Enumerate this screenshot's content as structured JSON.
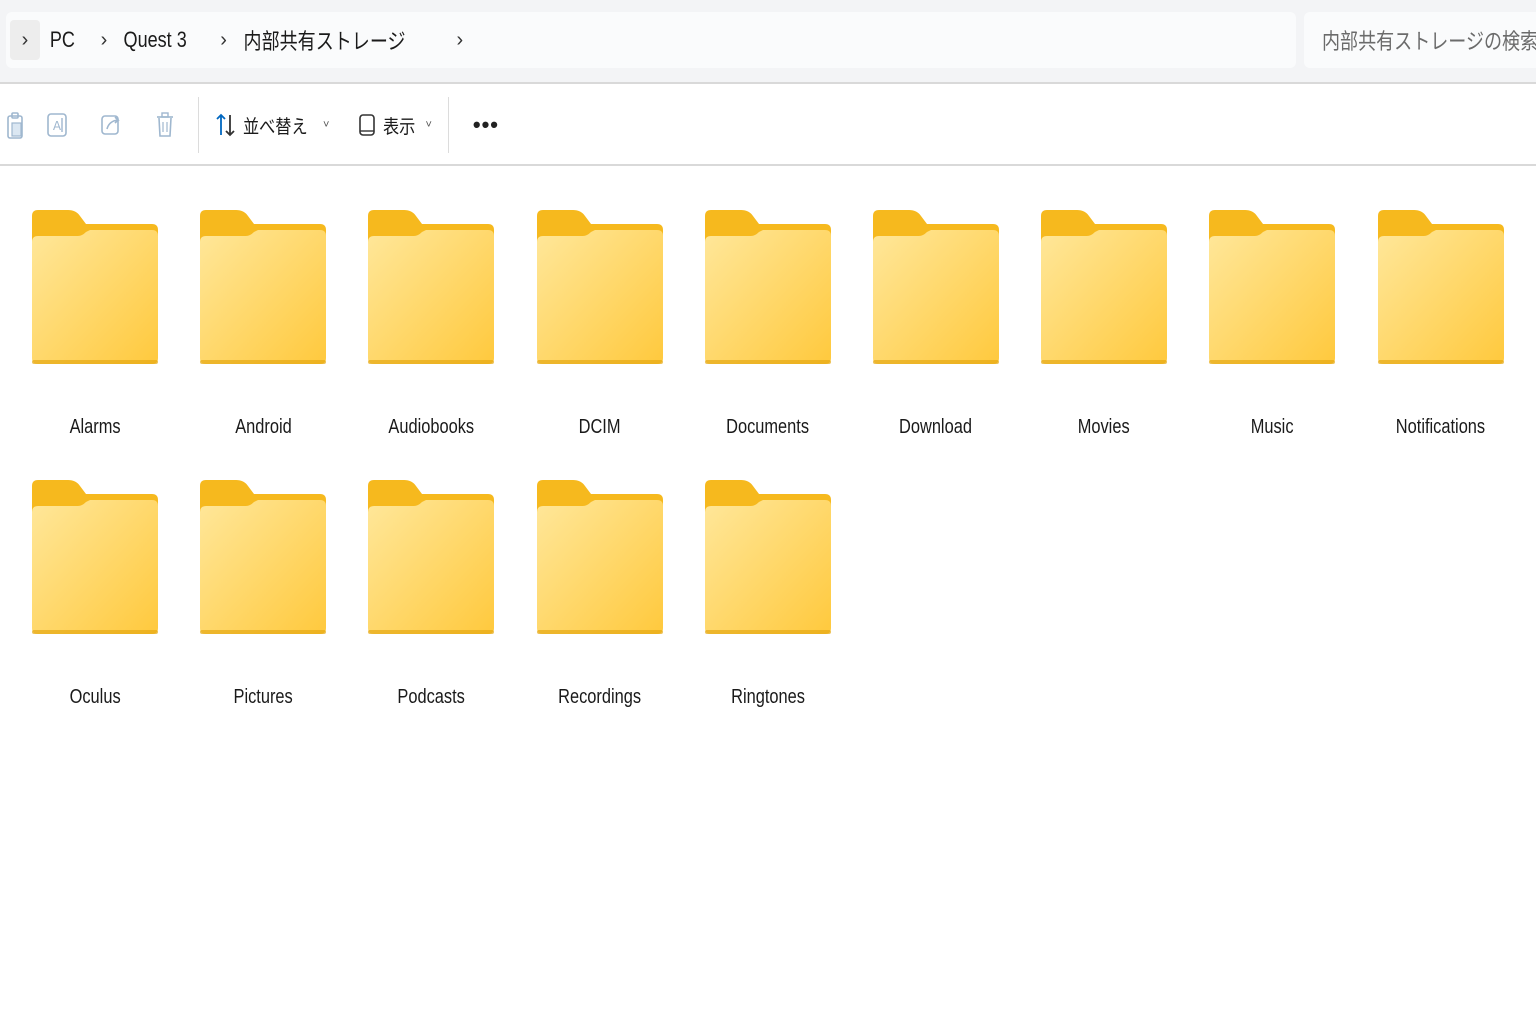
{
  "address_bar": {
    "breadcrumbs": [
      "PC",
      "Quest 3",
      "内部共有ストレージ"
    ]
  },
  "search": {
    "placeholder": "内部共有ストレージの検索"
  },
  "toolbar": {
    "icons": [
      "paste-icon",
      "rename-icon",
      "share-icon",
      "delete-icon"
    ],
    "sort_label": "並べ替え",
    "view_label": "表示",
    "more_label": "•••"
  },
  "folders": [
    {
      "name": "Alarms"
    },
    {
      "name": "Android"
    },
    {
      "name": "Audiobooks"
    },
    {
      "name": "DCIM"
    },
    {
      "name": "Documents"
    },
    {
      "name": "Download"
    },
    {
      "name": "Movies"
    },
    {
      "name": "Music"
    },
    {
      "name": "Notifications"
    },
    {
      "name": "Oculus"
    },
    {
      "name": "Pictures"
    },
    {
      "name": "Podcasts"
    },
    {
      "name": "Recordings"
    },
    {
      "name": "Ringtones"
    }
  ],
  "colors": {
    "folder_back": "#f6b91e",
    "folder_front_light": "#ffe79a",
    "folder_front_dark": "#ffc93d",
    "icon_disabled": "#9fb7cf",
    "accent": "#0067c0"
  }
}
